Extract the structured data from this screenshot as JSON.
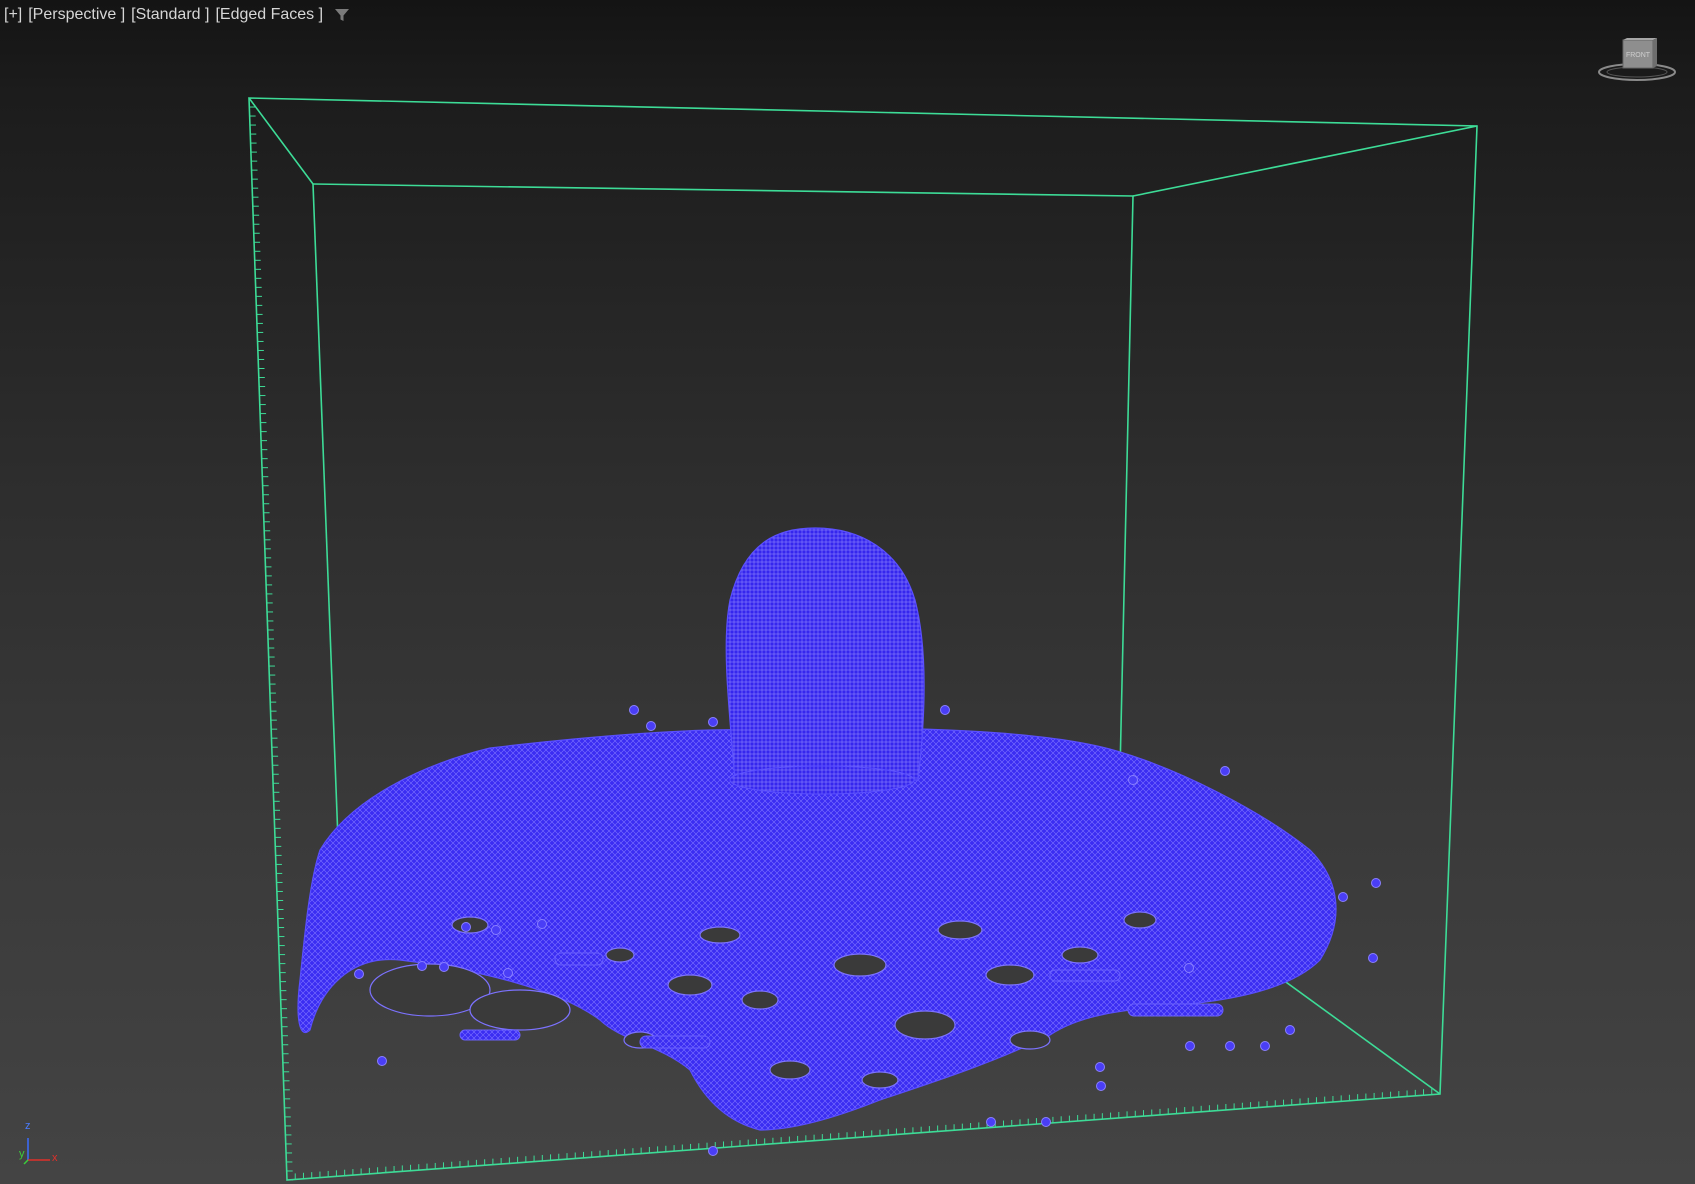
{
  "viewport": {
    "labels": [
      "[+]",
      "[Perspective ]",
      "[Standard ]",
      "[Edged Faces ]"
    ],
    "filter_icon": "filter-icon"
  },
  "viewcube": {
    "face_label": "FRONT"
  },
  "axis_tripod": {
    "z": "z",
    "y": "y",
    "x": "x"
  },
  "colors": {
    "bounding_box": "#3ddc97",
    "mesh_fill": "#3a2cf0",
    "mesh_wire": "#8a80ff",
    "label_text": "#d6d6d6"
  }
}
